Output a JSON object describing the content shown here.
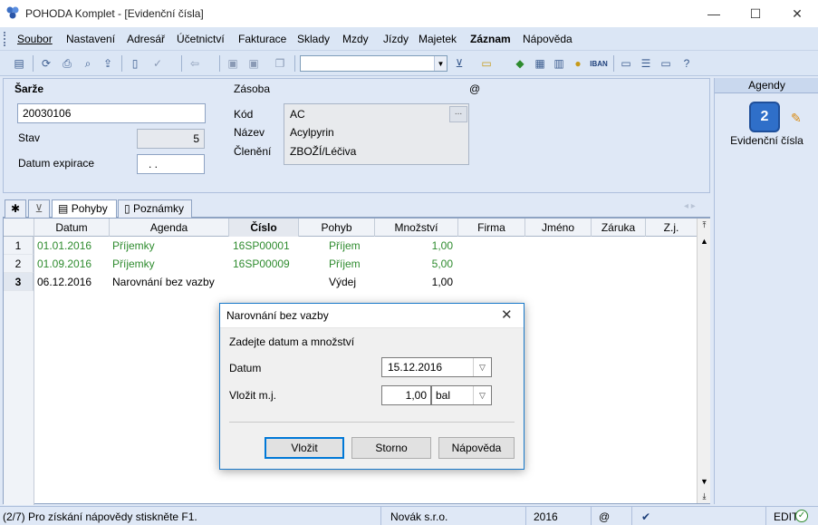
{
  "window": {
    "title": "POHODA Komplet - [Evidenční čísla]",
    "controls": {
      "minimize": "—",
      "maximize": "☐",
      "close": "✕"
    }
  },
  "menu": [
    "Soubor",
    "Nastavení",
    "Adresář",
    "Účetnictví",
    "Fakturace",
    "Sklady",
    "Mzdy",
    "Jízdy",
    "Majetek",
    "Záznam",
    "Nápověda"
  ],
  "toolbar": {
    "icons": [
      "book-icon",
      "refresh-icon",
      "print-icon",
      "print-preview-icon",
      "export-icon",
      "new-record-icon",
      "edit-icon",
      "back-arrow-icon",
      "save-icon",
      "save-as-icon",
      "copy-icon",
      "filter-icon",
      "folder-icon",
      "money-icon",
      "calculator-icon",
      "calendar-icon",
      "coins-icon",
      "iban-icon",
      "message-icon",
      "note-icon",
      "tip-icon",
      "help-icon"
    ],
    "iban_label": "IBAN"
  },
  "form": {
    "sarze_label": "Šarže",
    "sarze_value": "20030106",
    "stav_label": "Stav",
    "stav_value": "5",
    "expirace_label": "Datum expirace",
    "expirace_value": ". .",
    "zasoba_label": "Zásoba",
    "at_symbol": "@",
    "kod_label": "Kód",
    "kod_value": "AC",
    "nazev_label": "Název",
    "nazev_value": "Acylpyrin",
    "cleneni_label": "Členění",
    "cleneni_value": "ZBOŽÍ/Léčiva",
    "browse_button": "..."
  },
  "agenda": {
    "header": "Agendy",
    "item_label": "Evidenční čísla"
  },
  "tabs": {
    "star": "✱",
    "items": [
      "Pohyby",
      "Poznámky"
    ]
  },
  "grid": {
    "columns": [
      "Datum",
      "Agenda",
      "Číslo",
      "Pohyb",
      "Množství",
      "Firma",
      "Jméno",
      "Záruka",
      "Z.j."
    ],
    "rows": [
      {
        "num": "1",
        "datum": "01.01.2016",
        "agenda": "Příjemky",
        "cislo": "16SP00001",
        "pohyb": "Příjem",
        "mnozstvi": "1,00",
        "green": true
      },
      {
        "num": "2",
        "datum": "01.09.2016",
        "agenda": "Příjemky",
        "cislo": "16SP00009",
        "pohyb": "Příjem",
        "mnozstvi": "5,00",
        "green": true
      },
      {
        "num": "3",
        "datum": "06.12.2016",
        "agenda": "Narovnání bez vazby",
        "cislo": "",
        "pohyb": "Výdej",
        "mnozstvi": "1,00",
        "green": false
      }
    ]
  },
  "dialog": {
    "title": "Narovnání bez vazby",
    "prompt": "Zadejte datum a množství",
    "datum_label": "Datum",
    "datum_value": "15.12.2016",
    "vlozit_label": "Vložit m.j.",
    "mnozstvi_value": "1,00",
    "unit_value": "bal",
    "buttons": {
      "ok": "Vložit",
      "cancel": "Storno",
      "help": "Nápověda"
    }
  },
  "status": {
    "help_text": "(2/7) Pro získání nápovědy stiskněte F1.",
    "company": "Novák s.r.o.",
    "year": "2016",
    "at": "@",
    "mode": "EDIT"
  },
  "colors": {
    "accent": "#0078d7",
    "green_text": "#2e8b2e",
    "panel_bg": "#dfe8f6"
  }
}
